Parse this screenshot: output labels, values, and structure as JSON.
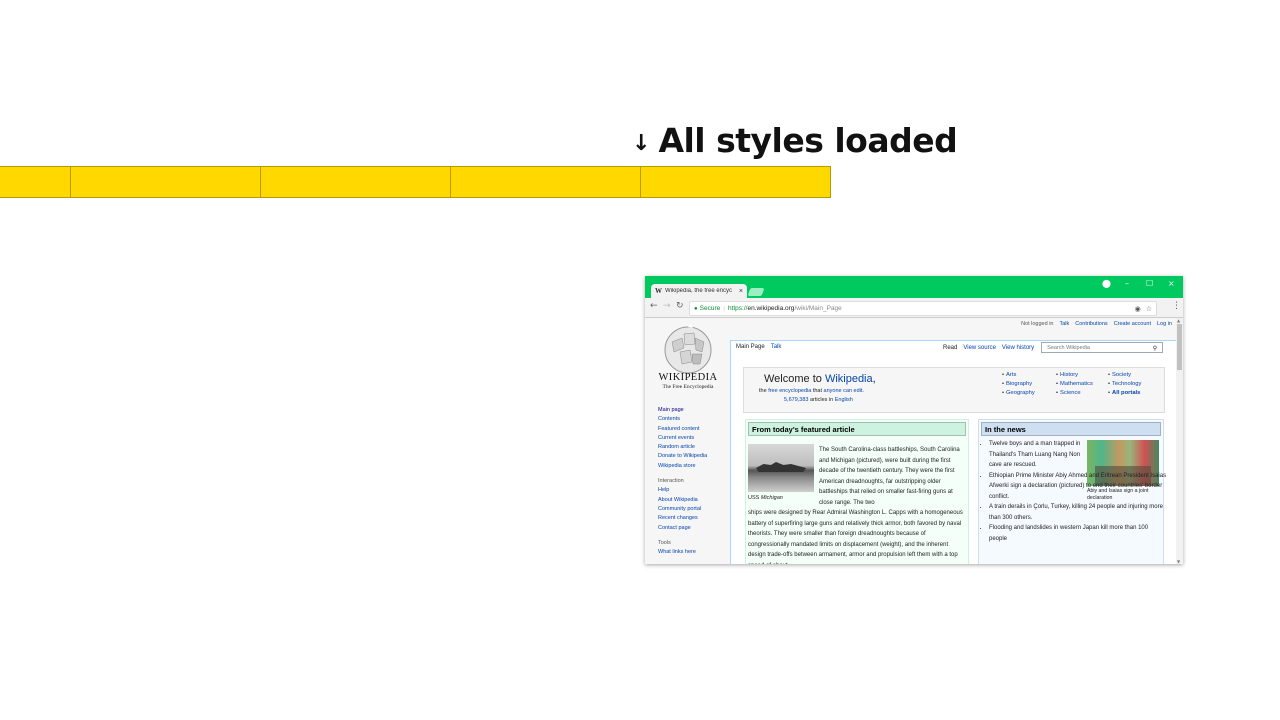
{
  "slide": {
    "arrow": "↓",
    "title": "All styles loaded",
    "timeline_color": "#ffd800"
  },
  "browser": {
    "accent_color": "#00c95f",
    "tab": {
      "favicon": "W",
      "title": "Wikipedia, the free encyc",
      "close": "×"
    },
    "window_controls": {
      "profile": "⬤",
      "minimize": "–",
      "maximize": "☐",
      "close": "×"
    },
    "nav": {
      "back": "←",
      "forward": "→",
      "reload": "↻"
    },
    "address": {
      "lock": "🔒",
      "secure": "Secure",
      "separator": "|",
      "scheme": "https://",
      "host": "en.wikipedia.org",
      "path": "/wiki/Main_Page"
    },
    "icons": [
      "extension-icon",
      "star-icon",
      "menu-icon"
    ]
  },
  "wiki": {
    "user_tools": {
      "not_logged_in": "Not logged in",
      "talk": "Talk",
      "contributions": "Contributions",
      "create_account": "Create account",
      "log_in": "Log in"
    },
    "logo": {
      "wordmark": "Wikipedia",
      "tagline": "The Free Encyclopedia"
    },
    "sidebar": {
      "main": [
        "Main page",
        "Contents",
        "Featured content",
        "Current events",
        "Random article",
        "Donate to Wikipedia",
        "Wikipedia store"
      ],
      "interaction_head": "Interaction",
      "interaction": [
        "Help",
        "About Wikipedia",
        "Community portal",
        "Recent changes",
        "Contact page"
      ],
      "tools_head": "Tools",
      "tools": [
        "What links here"
      ]
    },
    "tabs": {
      "main_page": "Main Page",
      "talk": "Talk",
      "read": "Read",
      "view_source": "View source",
      "view_history": "View history"
    },
    "search": {
      "placeholder": "Search Wikipedia",
      "icon": "🔍"
    },
    "welcome": {
      "prefix": "Welcome to ",
      "name": "Wikipedia",
      "comma": ",",
      "line2_a": "the ",
      "line2_link1": "free encyclopedia",
      "line2_b": " that ",
      "line2_link2": "anyone can edit",
      "line2_c": ".",
      "count": "5,679,383",
      "count_text": " articles in ",
      "language": "English"
    },
    "portals": [
      "Arts",
      "History",
      "Society",
      "Biography",
      "Mathematics",
      "Technology",
      "Geography",
      "Science",
      "All portals"
    ],
    "tfa": {
      "header": "From today's featured article",
      "caption_a": "USS ",
      "caption_b": "Michigan",
      "p1": "The South Carolina-class battleships, South Carolina and Michigan (pictured), were built during the first decade of the twentieth century. They were the first American dreadnoughts, far outstripping older battleships that relied on smaller fast-firing guns at close range. The two",
      "p2": "ships were designed by Rear Admiral Washington L. Capps with a homogeneous battery of superfiring large guns and relatively thick armor, both favored by naval theorists. They were smaller than foreign dreadnoughts because of congressionally mandated limits on displacement (weight), and the inherent design trade-offs between armament, armor and propulsion left them with a top speed of about"
    },
    "itn": {
      "header": "In the news",
      "caption": "Abiy and Isaias sign a joint declaration",
      "items": [
        "Twelve boys and a man trapped in Thailand's Tham Luang Nang Non cave are rescued.",
        "Ethiopian Prime Minister Abiy Ahmed and Eritrean President Isaias Afwerki sign a declaration (pictured) to end their countries' border conflict.",
        "A train derails in Çorlu, Turkey, killing 24 people and injuring more than 300 others.",
        "Flooding and landslides in western Japan kill more than 100 people"
      ]
    }
  }
}
